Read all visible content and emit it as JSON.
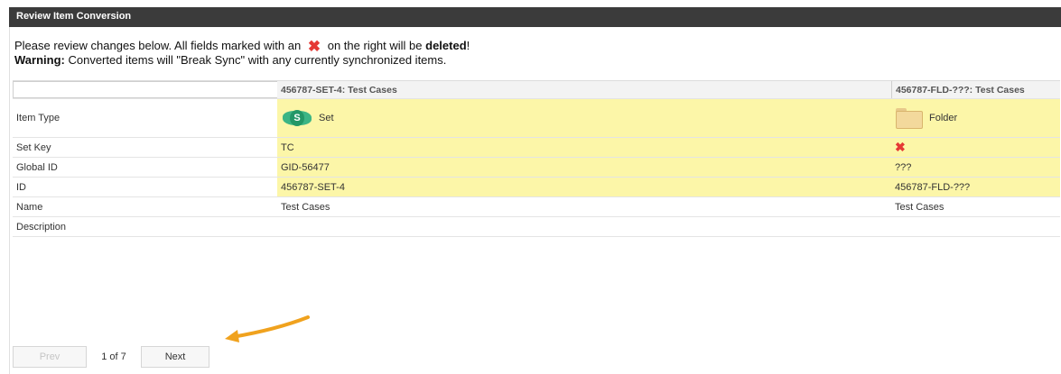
{
  "window": {
    "title": "Review Item Conversion"
  },
  "message": {
    "line1_pre": "Please review changes below.  All fields marked with an",
    "x_glyph": "✖",
    "line1_mid": "on the right will be",
    "line1_bold": "deleted",
    "line1_end": "!",
    "line2_bold": "Warning:",
    "line2": "Converted items will \"Break Sync\" with any currently synchronized items."
  },
  "table": {
    "columns": [
      "",
      "456787-SET-4: Test Cases",
      "456787-FLD-???: Test Cases"
    ],
    "rows": [
      {
        "field": "Item Type",
        "source": "Set",
        "target": "Folder",
        "source_icon": "set-icon",
        "target_icon": "folder-icon",
        "highlight": true
      },
      {
        "field": "Set Key",
        "source": "TC",
        "target": "✖",
        "highlight": true
      },
      {
        "field": "Global ID",
        "source": "GID-56477",
        "target": "???",
        "highlight": true
      },
      {
        "field": "ID",
        "source": "456787-SET-4",
        "target": "456787-FLD-???",
        "highlight": true
      },
      {
        "field": "Name",
        "source": "Test Cases",
        "target": "Test Cases",
        "highlight": false
      },
      {
        "field": "Description",
        "source": "",
        "target": "",
        "highlight": false
      }
    ],
    "set_icon_letter": "S"
  },
  "pager": {
    "prev_label": "Prev",
    "page_info": "1 of 7",
    "next_label": "Next"
  },
  "colors": {
    "highlight": "#fcf6a8",
    "delete_x": "#e53935",
    "titlebar": "#3b3b3b",
    "arrow": "#f0a21e"
  }
}
